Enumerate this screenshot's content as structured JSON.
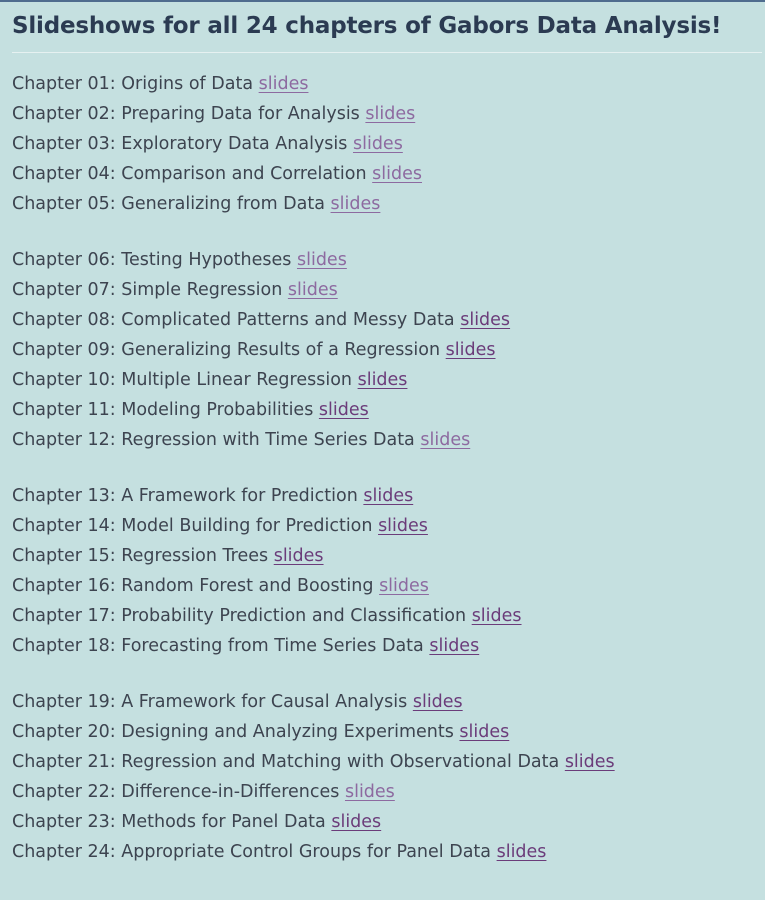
{
  "title": "Slideshows for all 24 chapters of Gabors Data Analysis!",
  "groups": [
    {
      "chapters": [
        {
          "label": "Chapter 01: Origins of Data",
          "link": "slides",
          "visited": true
        },
        {
          "label": "Chapter 02: Preparing Data for Analysis",
          "link": "slides",
          "visited": true
        },
        {
          "label": "Chapter 03: Exploratory Data Analysis",
          "link": "slides",
          "visited": true
        },
        {
          "label": "Chapter 04: Comparison and Correlation",
          "link": "slides",
          "visited": true
        },
        {
          "label": "Chapter 05: Generalizing from Data",
          "link": "slides",
          "visited": true
        }
      ]
    },
    {
      "chapters": [
        {
          "label": "Chapter 06: Testing Hypotheses",
          "link": "slides",
          "visited": true
        },
        {
          "label": "Chapter 07: Simple Regression",
          "link": "slides",
          "visited": true
        },
        {
          "label": "Chapter 08: Complicated Patterns and Messy Data",
          "link": "slides",
          "visited": false
        },
        {
          "label": "Chapter 09: Generalizing Results of a Regression",
          "link": "slides",
          "visited": false
        },
        {
          "label": "Chapter 10: Multiple Linear Regression",
          "link": "slides",
          "visited": false
        },
        {
          "label": "Chapter 11: Modeling Probabilities",
          "link": "slides",
          "visited": false
        },
        {
          "label": "Chapter 12: Regression with Time Series Data",
          "link": "slides",
          "visited": true
        }
      ]
    },
    {
      "chapters": [
        {
          "label": "Chapter 13: A Framework for Prediction",
          "link": "slides",
          "visited": false
        },
        {
          "label": "Chapter 14: Model Building for Prediction",
          "link": "slides",
          "visited": false
        },
        {
          "label": "Chapter 15: Regression Trees",
          "link": "slides",
          "visited": false
        },
        {
          "label": "Chapter 16: Random Forest and Boosting",
          "link": "slides",
          "visited": true
        },
        {
          "label": "Chapter 17: Probability Prediction and Classification",
          "link": "slides",
          "visited": false
        },
        {
          "label": "Chapter 18: Forecasting from Time Series Data",
          "link": "slides",
          "visited": false
        }
      ]
    },
    {
      "chapters": [
        {
          "label": "Chapter 19: A Framework for Causal Analysis",
          "link": "slides",
          "visited": false
        },
        {
          "label": "Chapter 20: Designing and Analyzing Experiments",
          "link": "slides",
          "visited": false
        },
        {
          "label": "Chapter 21: Regression and Matching with Observational Data",
          "link": "slides",
          "visited": false
        },
        {
          "label": "Chapter 22: Difference-in-Differences",
          "link": "slides",
          "visited": true
        },
        {
          "label": "Chapter 23: Methods for Panel Data",
          "link": "slides",
          "visited": false
        },
        {
          "label": "Chapter 24: Appropriate Control Groups for Panel Data",
          "link": "slides",
          "visited": false
        }
      ]
    }
  ],
  "colors": {
    "background": "#c5e0e0",
    "title": "#2b3b52",
    "text": "#3d4450",
    "link": "#6b3c7a",
    "link_visited": "#8d6aa0"
  }
}
